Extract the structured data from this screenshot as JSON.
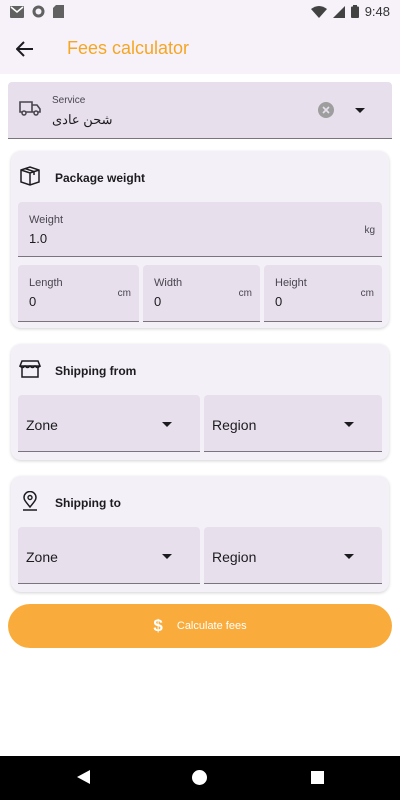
{
  "status_bar": {
    "time": "9:48"
  },
  "app_bar": {
    "title": "Fees calculator",
    "back_icon": "arrow-back-icon"
  },
  "service": {
    "label": "Service",
    "value": "شحن عادى"
  },
  "package": {
    "title": "Package weight",
    "weight": {
      "label": "Weight",
      "value": "1.0",
      "unit": "kg"
    },
    "length": {
      "label": "Length",
      "value": "0",
      "unit": "cm"
    },
    "width": {
      "label": "Width",
      "value": "0",
      "unit": "cm"
    },
    "height": {
      "label": "Height",
      "value": "0",
      "unit": "cm"
    }
  },
  "shipping_from": {
    "title": "Shipping from",
    "zone": "Zone",
    "region": "Region"
  },
  "shipping_to": {
    "title": "Shipping to",
    "zone": "Zone",
    "region": "Region"
  },
  "calculate_button": {
    "label": "Calculate fees",
    "icon": "$"
  },
  "colors": {
    "accent": "#f5a623",
    "button": "#f9ac3c",
    "field_bg": "#e7e0ec",
    "card_bg": "#f4f0f7"
  }
}
